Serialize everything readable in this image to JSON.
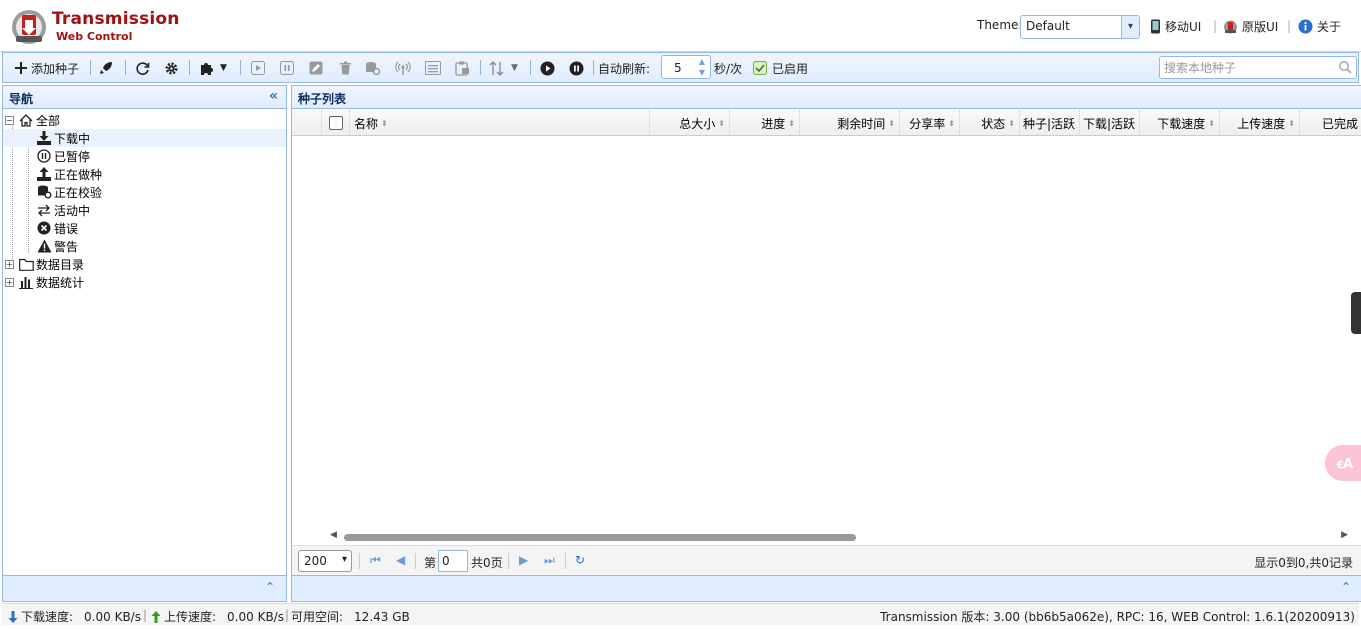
{
  "header": {
    "title": "Transmission",
    "subtitle": "Web Control",
    "theme_label": "Theme:",
    "theme_value": "Default",
    "mobile_ui": "移动UI",
    "original_ui": "原版UI",
    "about": "关于",
    "separator": "|"
  },
  "toolbar": {
    "add_torrent": "添加种子",
    "auto_refresh_label": "自动刷新:",
    "refresh_value": "5",
    "refresh_unit": "秒/次",
    "enabled_label": "已启用",
    "search_placeholder": "搜索本地种子"
  },
  "nav": {
    "title": "导航",
    "items": [
      {
        "label": "全部",
        "icon": "home-icon"
      },
      {
        "label": "下载中",
        "icon": "download-icon"
      },
      {
        "label": "已暂停",
        "icon": "pause-circle-icon"
      },
      {
        "label": "正在做种",
        "icon": "upload-icon"
      },
      {
        "label": "正在校验",
        "icon": "check-data-icon"
      },
      {
        "label": "活动中",
        "icon": "exchange-icon"
      },
      {
        "label": "错误",
        "icon": "error-icon"
      },
      {
        "label": "警告",
        "icon": "warning-icon"
      },
      {
        "label": "数据目录",
        "icon": "folder-icon"
      },
      {
        "label": "数据统计",
        "icon": "chart-icon"
      }
    ]
  },
  "torrent_list": {
    "title": "种子列表",
    "columns": [
      "名称",
      "总大小",
      "进度",
      "剩余时间",
      "分享率",
      "状态",
      "种子|活跃",
      "下载|活跃",
      "下载速度",
      "上传速度",
      "已完成"
    ]
  },
  "pager": {
    "page_size": "200",
    "page_prefix": "第",
    "page_value": "0",
    "page_total": "共0页",
    "record_info": "显示0到0,共0记录"
  },
  "status": {
    "download_label": "下载速度:",
    "download_value": "0.00 KB/s",
    "upload_label": "上传速度:",
    "upload_value": "0.00 KB/s",
    "free_space_label": "可用空间:",
    "free_space_value": "12.43 GB",
    "version_text": "Transmission 版本: 3.00 (bb6b5a062e), RPC: 16, WEB Control: 1.6.1(20200913)"
  },
  "floating": {
    "translate_text": "ꞓA"
  },
  "colors": {
    "brand": "#a31212",
    "panel_border": "#95b8e7",
    "panel_bg": "#e0ecff"
  }
}
